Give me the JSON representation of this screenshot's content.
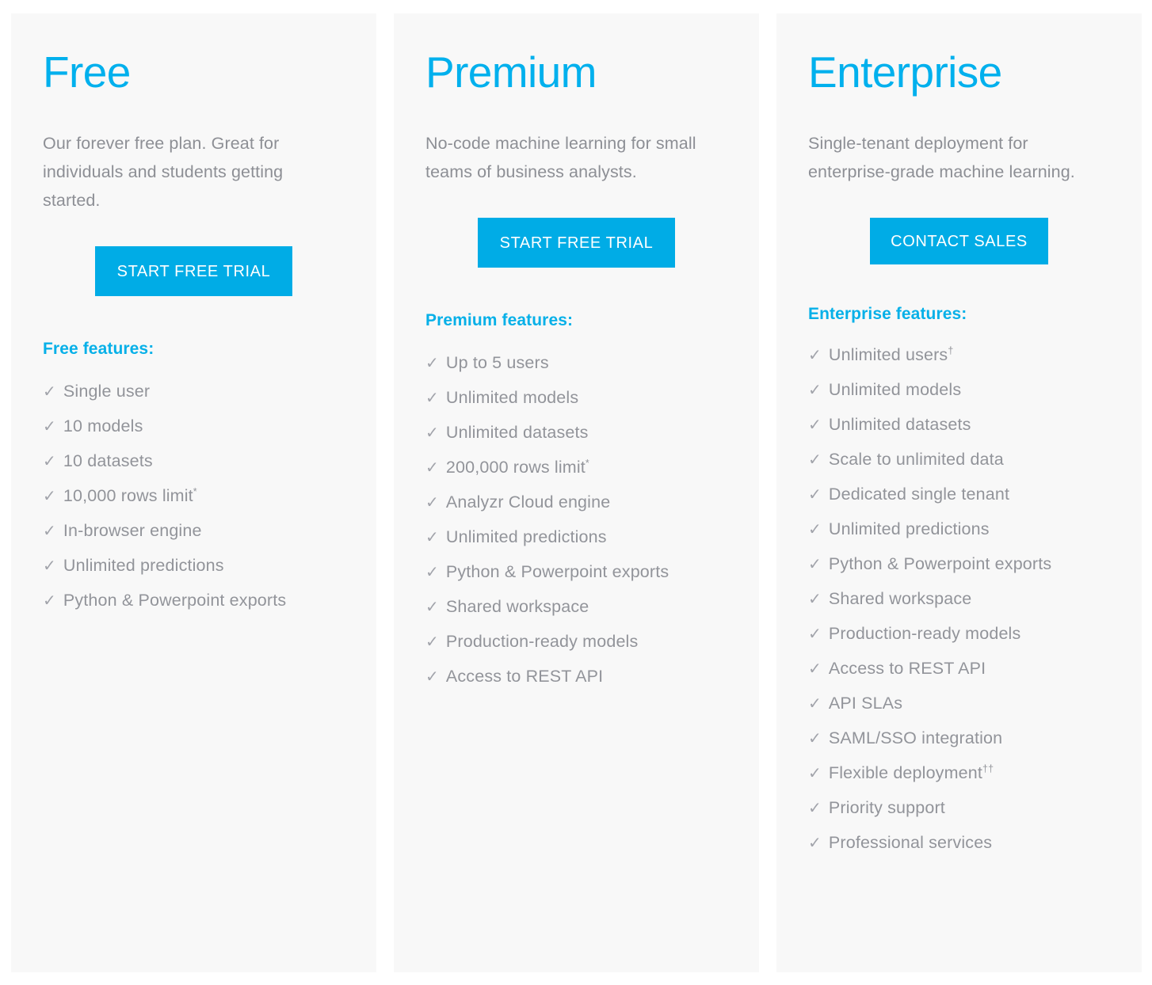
{
  "accent": {
    "title_color": "#00b0ed",
    "heading_color": "#06b0e8",
    "button_color": "#00ace6",
    "text_color": "#92949a",
    "card_background": "#f8f8f8",
    "page_background": "#ffffff"
  },
  "icons": {
    "check": "✓"
  },
  "plans": [
    {
      "id": "free",
      "title": "Free",
      "tagline": "Our forever free plan. Great for individuals and students getting started.",
      "cta_label": "START FREE TRIAL",
      "features_heading": "Free features:",
      "features": [
        {
          "label": "Single user",
          "note": ""
        },
        {
          "label": "10 models",
          "note": ""
        },
        {
          "label": "10 datasets",
          "note": ""
        },
        {
          "label": "10,000 rows limit",
          "note": "*"
        },
        {
          "label": "In-browser engine",
          "note": ""
        },
        {
          "label": "Unlimited predictions",
          "note": ""
        },
        {
          "label": "Python & Powerpoint exports",
          "note": ""
        }
      ]
    },
    {
      "id": "premium",
      "title": "Premium",
      "tagline": "No-code machine learning for small teams of business analysts.",
      "cta_label": "START FREE TRIAL",
      "features_heading": "Premium features:",
      "features": [
        {
          "label": "Up to 5 users",
          "note": ""
        },
        {
          "label": "Unlimited models",
          "note": ""
        },
        {
          "label": "Unlimited datasets",
          "note": ""
        },
        {
          "label": "200,000 rows limit",
          "note": "*"
        },
        {
          "label": "Analyzr Cloud engine",
          "note": ""
        },
        {
          "label": "Unlimited predictions",
          "note": ""
        },
        {
          "label": "Python & Powerpoint exports",
          "note": ""
        },
        {
          "label": "Shared workspace",
          "note": ""
        },
        {
          "label": "Production-ready models",
          "note": ""
        },
        {
          "label": "Access to REST API",
          "note": ""
        }
      ]
    },
    {
      "id": "enterprise",
      "title": "Enterprise",
      "tagline": "Single-tenant deployment for enterprise-grade machine learning.",
      "cta_label": "CONTACT SALES",
      "features_heading": "Enterprise features:",
      "features": [
        {
          "label": "Unlimited users",
          "note": "†"
        },
        {
          "label": "Unlimited models",
          "note": ""
        },
        {
          "label": "Unlimited datasets",
          "note": ""
        },
        {
          "label": "Scale to unlimited data",
          "note": ""
        },
        {
          "label": "Dedicated single tenant",
          "note": ""
        },
        {
          "label": "Unlimited predictions",
          "note": ""
        },
        {
          "label": "Python & Powerpoint exports",
          "note": ""
        },
        {
          "label": "Shared workspace",
          "note": ""
        },
        {
          "label": "Production-ready models",
          "note": ""
        },
        {
          "label": "Access to REST API",
          "note": ""
        },
        {
          "label": "API SLAs",
          "note": ""
        },
        {
          "label": "SAML/SSO integration",
          "note": ""
        },
        {
          "label": "Flexible deployment",
          "note": "††"
        },
        {
          "label": "Priority support",
          "note": ""
        },
        {
          "label": "Professional services",
          "note": ""
        }
      ]
    }
  ]
}
